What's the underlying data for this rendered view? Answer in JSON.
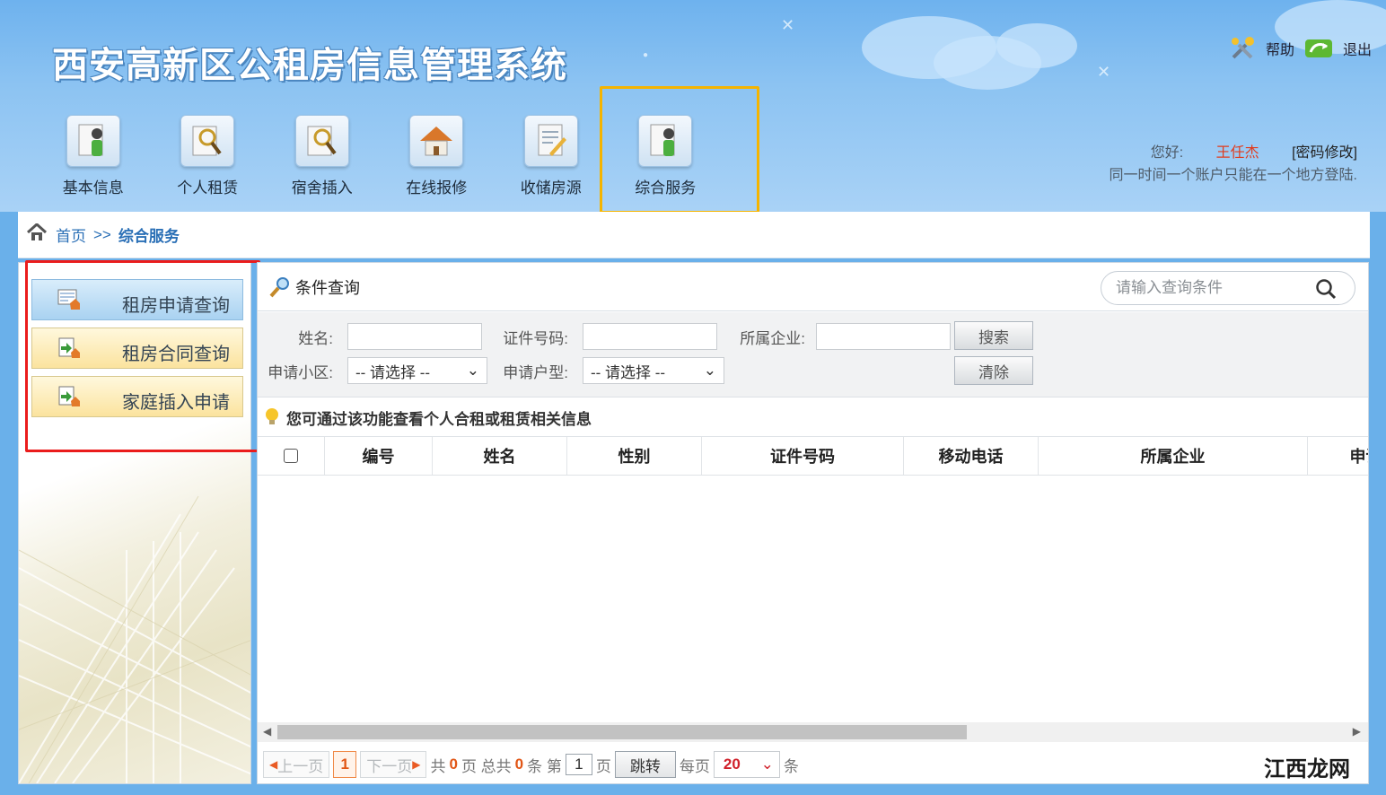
{
  "header": {
    "title": "西安高新区公租房信息管理系统",
    "help_label": "帮助",
    "exit_label": "退出"
  },
  "nav": {
    "items": [
      {
        "label": "基本信息",
        "icon": "person-doc-icon"
      },
      {
        "label": "个人租赁",
        "icon": "magnifier-doc-icon"
      },
      {
        "label": "宿舍插入",
        "icon": "magnifier-doc-icon"
      },
      {
        "label": "在线报修",
        "icon": "house-icon"
      },
      {
        "label": "收储房源",
        "icon": "edit-doc-icon"
      },
      {
        "label": "综合服务",
        "icon": "person-doc-icon"
      }
    ],
    "active": "综合服务"
  },
  "user": {
    "greeting": "您好:",
    "name": "王任杰",
    "change_password": "[密码修改]",
    "notice": "同一时间一个账户只能在一个地方登陆."
  },
  "breadcrumb": {
    "home": "首页",
    "sep": ">>",
    "current": "综合服务"
  },
  "sidebar": {
    "items": [
      {
        "label": "租房申请查询",
        "active": true
      },
      {
        "label": "租房合同查询",
        "active": false
      },
      {
        "label": "家庭插入申请",
        "active": false
      }
    ]
  },
  "query": {
    "title": "条件查询",
    "search_placeholder": "请输入查询条件",
    "name_label": "姓名:",
    "id_label": "证件号码:",
    "company_label": "所属企业:",
    "community_label": "申请小区:",
    "community_value": "-- 请选择 --",
    "type_label": "申请户型:",
    "type_value": "-- 请选择 --",
    "search_btn": "搜索",
    "clear_btn": "清除"
  },
  "tip": "您可通过该功能查看个人合租或租赁相关信息",
  "table": {
    "columns": [
      "编号",
      "姓名",
      "性别",
      "证件号码",
      "移动电话",
      "所属企业",
      "申请"
    ]
  },
  "pager": {
    "prev": "上一页",
    "current_page": "1",
    "next": "下一页",
    "total_prefix": "共",
    "total_pages": "0",
    "total_mid": "页 总共",
    "total_records": "0",
    "total_suffix": "条 第",
    "page_input": "1",
    "page_unit": "页",
    "go": "跳转",
    "per_page_label": "每页",
    "per_page": "20",
    "per_page_unit": "条"
  },
  "watermark": "江西龙网",
  "colors": {
    "highlight_nav": "#f5b400",
    "highlight_sidebar": "#ea1c1c",
    "link": "#2a6fb6",
    "username": "#e03b1d"
  }
}
